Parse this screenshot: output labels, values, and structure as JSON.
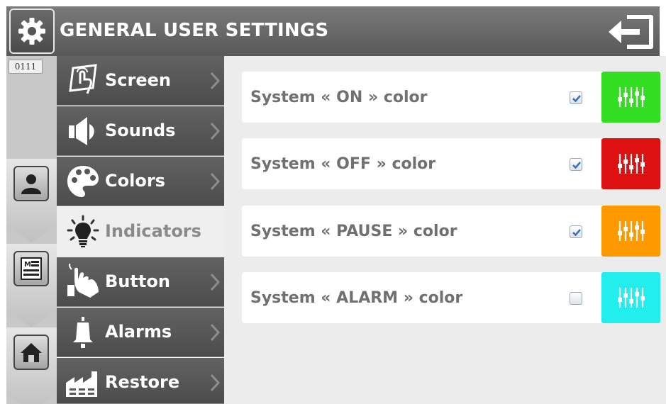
{
  "header": {
    "title": "GENERAL USER SETTINGS",
    "icon": "gear-icon",
    "exit_icon": "exit-arrow-icon"
  },
  "rail": {
    "counter": "0111",
    "tabs": [
      {
        "icon": "user-profile-icon"
      },
      {
        "icon": "document-list-icon"
      },
      {
        "icon": "home-icon"
      }
    ]
  },
  "menu": {
    "items": [
      {
        "label": "Screen",
        "icon": "touch-screen-icon",
        "active": false
      },
      {
        "label": "Sounds",
        "icon": "speaker-icon",
        "active": false
      },
      {
        "label": "Colors",
        "icon": "palette-icon",
        "active": false
      },
      {
        "label": "Indicators",
        "icon": "lightbulb-icon",
        "active": true
      },
      {
        "label": "Button",
        "icon": "hand-press-icon",
        "active": false
      },
      {
        "label": "Alarms",
        "icon": "bell-icon",
        "active": false
      },
      {
        "label": "Restore",
        "icon": "factory-icon",
        "active": false
      }
    ]
  },
  "settings": {
    "rows": [
      {
        "label": "System « ON » color",
        "checked": true,
        "color": "#33dd22"
      },
      {
        "label": "System « OFF » color",
        "checked": true,
        "color": "#dd1111"
      },
      {
        "label": "System « PAUSE » color",
        "checked": true,
        "color": "#ff9900"
      },
      {
        "label": "System « ALARM » color",
        "checked": false,
        "color": "#22eeee"
      }
    ]
  },
  "colors": {
    "header_bg": "#646464",
    "menu_bg": "#575757",
    "content_bg": "#ececec",
    "label_text": "#707070"
  }
}
